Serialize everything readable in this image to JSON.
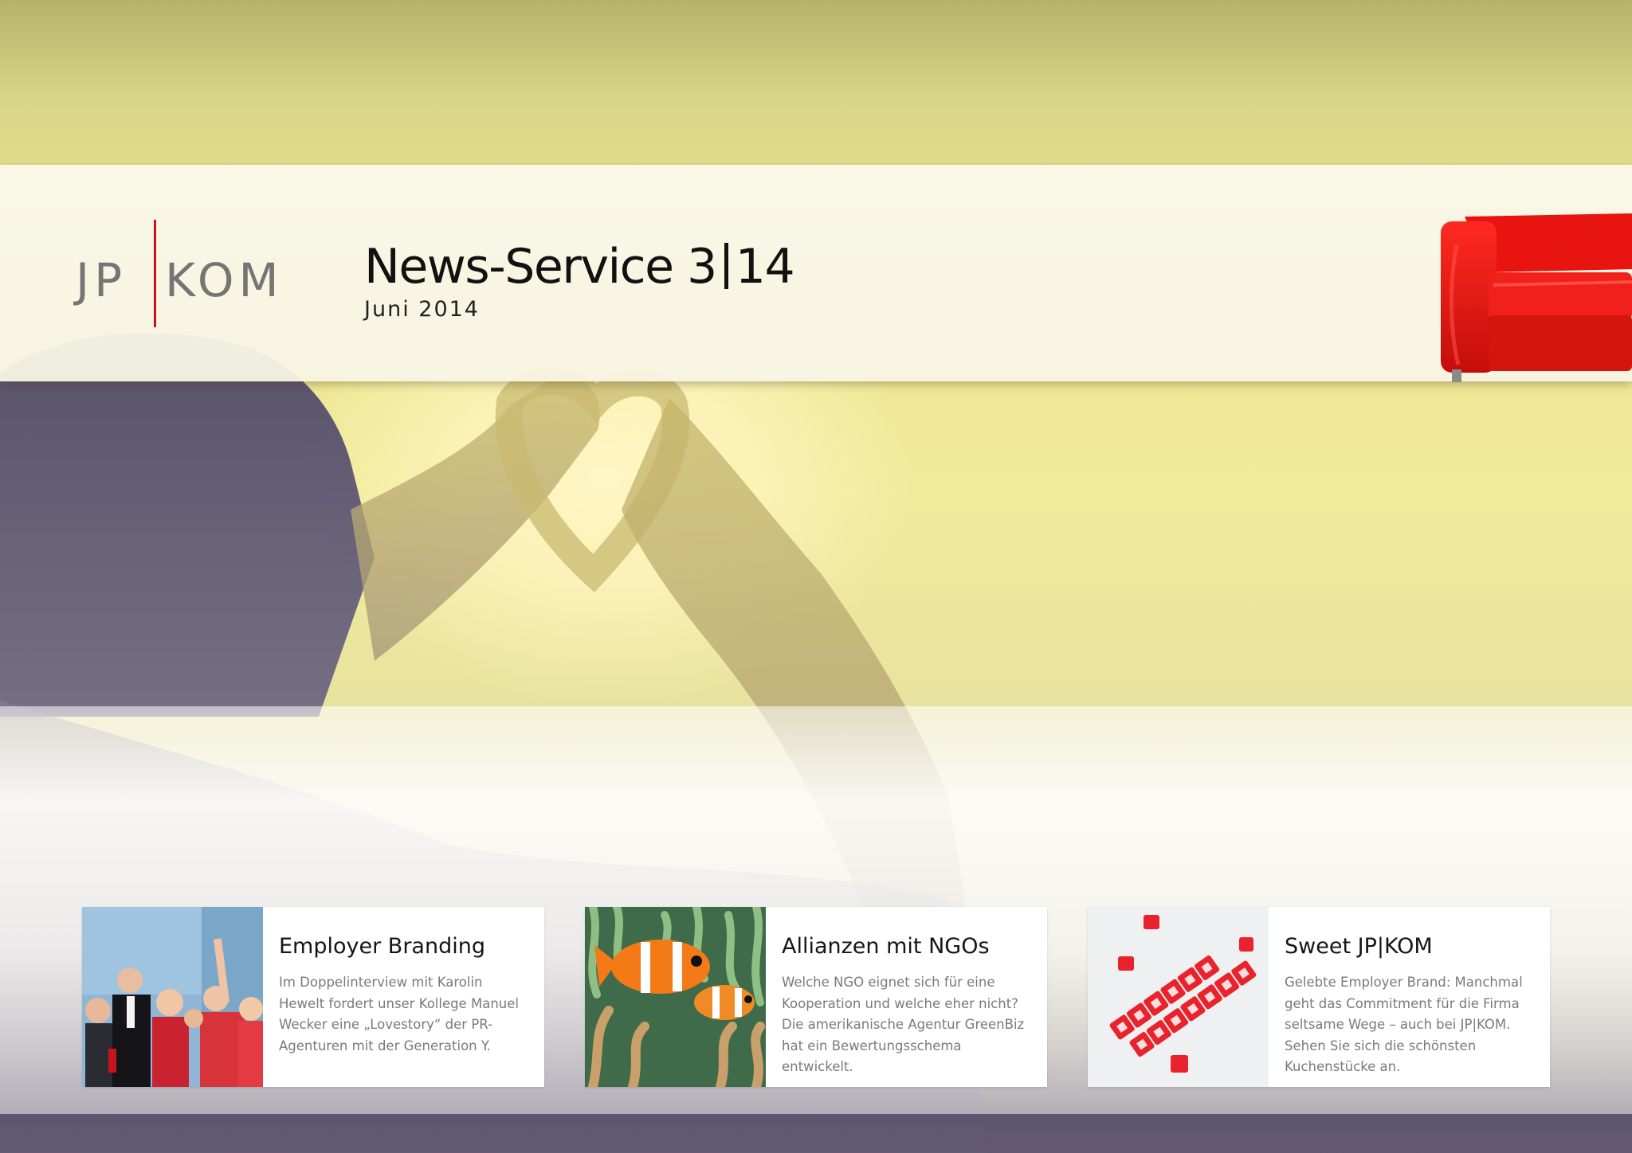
{
  "header": {
    "logo_left": "JP",
    "logo_right": "KOM",
    "title_main": "News-Service 3",
    "title_issue": "14",
    "date": "Juni 2014"
  },
  "colors": {
    "brand_red": "#c8141e",
    "logo_gray": "#757575",
    "text_dark": "#111111",
    "text_muted": "#7a7a7a"
  },
  "articles": [
    {
      "image": "award-stage-photo",
      "title": "Employer Branding",
      "text": "Im Doppelinterview mit Karolin Hewelt fordert unser Kollege Manuel Wecker eine „Lovestory“ der PR-Agenturen mit der Generation Y."
    },
    {
      "image": "clownfish-photo",
      "title": "Allianzen mit NGOs",
      "text": "Welche NGO eignet sich für eine Kooperation und welche eher nicht? Die amerikanische Agentur GreenBiz hat ein Bewertungsschema entwickelt."
    },
    {
      "image": "sugar-letters-photo",
      "title": "Sweet JP|KOM",
      "text": "Gelebte Employer Brand: Manchmal geht das Commitment für die Firma seltsame Wege – auch bei JP|KOM. Sehen Sie sich die schönsten Kuchenstücke an."
    }
  ]
}
